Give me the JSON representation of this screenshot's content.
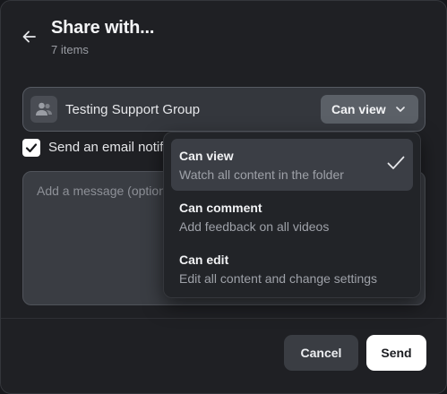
{
  "header": {
    "title": "Share with...",
    "subtitle": "7 items"
  },
  "recipient": {
    "name": "Testing Support Group",
    "permission": "Can view"
  },
  "email": {
    "label": "Send an email notification",
    "checked": true
  },
  "message": {
    "placeholder": "Add a message (optional)"
  },
  "footer": {
    "cancel_label": "Cancel",
    "send_label": "Send"
  },
  "dropdown": {
    "selected_index": 0,
    "options": [
      {
        "title": "Can view",
        "description": "Watch all content in the folder"
      },
      {
        "title": "Can comment",
        "description": "Add feedback on all videos"
      },
      {
        "title": "Can edit",
        "description": "Edit all content and change settings"
      }
    ]
  },
  "icons": {
    "back": "arrow-left-icon",
    "group": "users-icon",
    "chevron": "chevron-down-icon",
    "checkbox": "check-icon",
    "selected": "check-icon"
  },
  "colors": {
    "background": "#1f2024",
    "surface": "#34373d",
    "primary_button": "#ffffff",
    "selected_item": "#3b3e45"
  }
}
